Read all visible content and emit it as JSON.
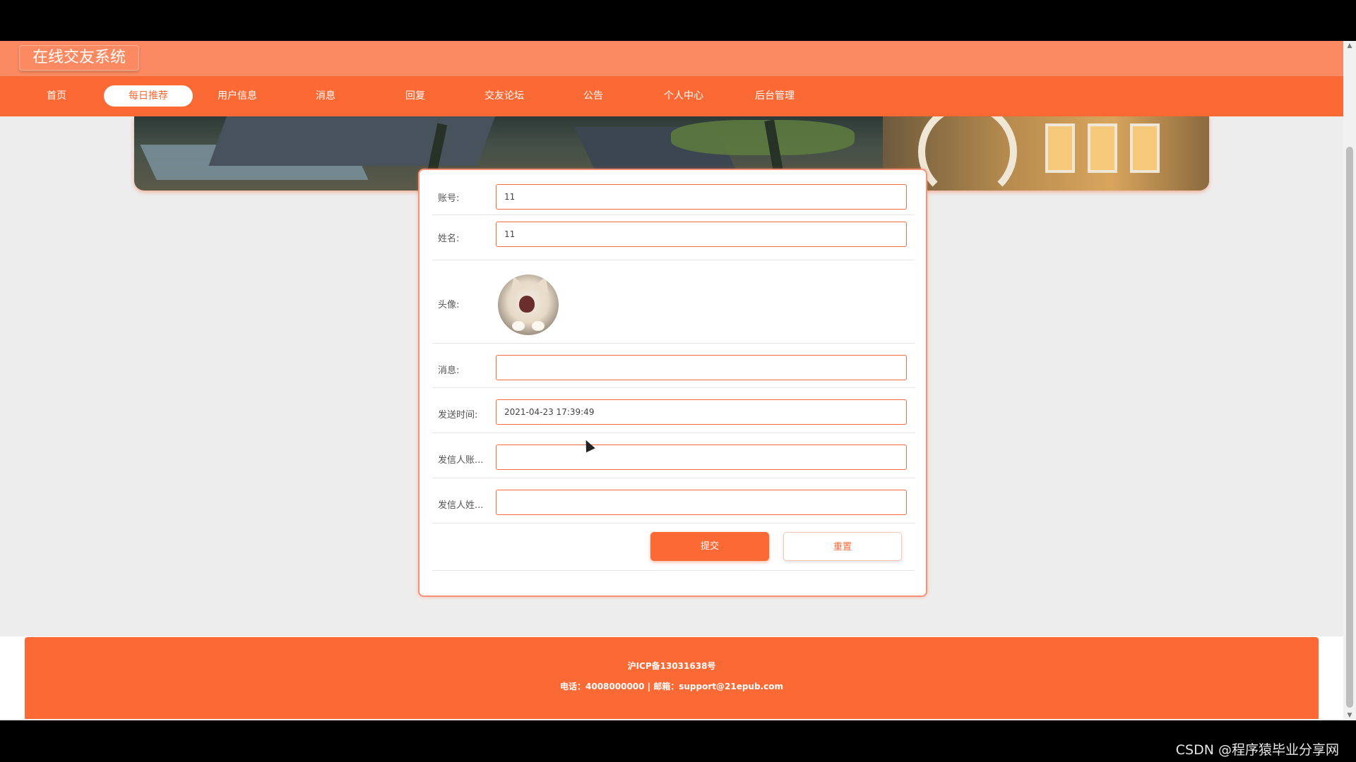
{
  "header": {
    "site_title": "在线交友系统"
  },
  "nav": {
    "items": [
      {
        "label": "首页",
        "active": false
      },
      {
        "label": "每日推荐",
        "active": true
      },
      {
        "label": "用户信息",
        "active": false
      },
      {
        "label": "消息",
        "active": false
      },
      {
        "label": "回复",
        "active": false
      },
      {
        "label": "交友论坛",
        "active": false
      },
      {
        "label": "公告",
        "active": false
      },
      {
        "label": "个人中心",
        "active": false
      },
      {
        "label": "后台管理",
        "active": false
      }
    ]
  },
  "banner": {
    "slide_count": 3,
    "active_slide": 1
  },
  "form": {
    "account": {
      "label": "账号:",
      "value": "11"
    },
    "name": {
      "label": "姓名:",
      "value": "11"
    },
    "avatar": {
      "label": "头像:"
    },
    "message": {
      "label": "消息:",
      "value": ""
    },
    "send_time": {
      "label": "发送时间:",
      "value": "2021-04-23 17:39:49"
    },
    "sender_account": {
      "label": "发信人账...",
      "value": ""
    },
    "sender_name": {
      "label": "发信人姓...",
      "value": ""
    },
    "submit_label": "提交",
    "reset_label": "重置"
  },
  "footer": {
    "icp": "沪ICP备13031638号",
    "contact": "电话：4008000000 | 邮箱：support@21epub.com"
  },
  "watermark": "CSDN @程序猿毕业分享网",
  "colors": {
    "accent": "#fb6935",
    "title_strip": "#fb8a62",
    "page_background": "#ededed"
  }
}
